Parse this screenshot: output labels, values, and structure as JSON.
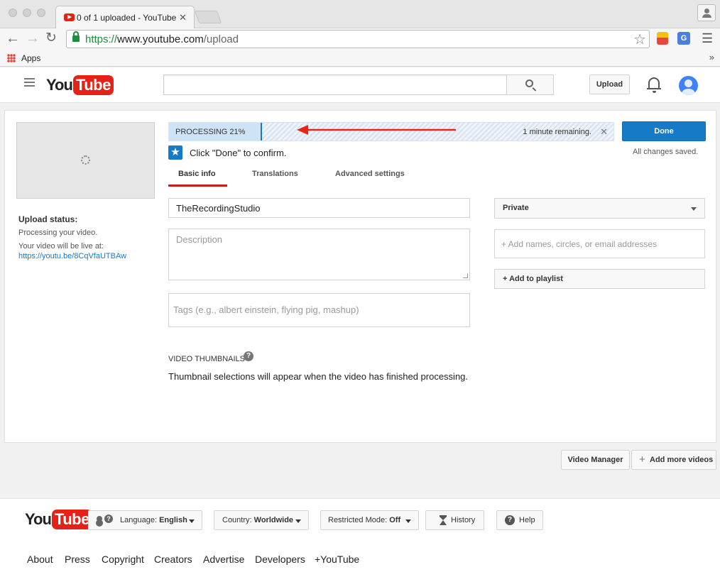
{
  "browser": {
    "tab_title": "0 of 1 uploaded - YouTube",
    "tab_close": "✕",
    "url_scheme": "https://",
    "url_host": "www.youtube.com",
    "url_path": "/upload",
    "bookmarks_apps": "Apps",
    "bookmarks_more": "»"
  },
  "youtube": {
    "logo_you": "You",
    "logo_tube": "Tube",
    "upload_button": "Upload"
  },
  "upload": {
    "status_title": "Upload status:",
    "processing_msg": "Processing your video.",
    "live_at": "Your video will be live at:",
    "live_link": "https://youtu.be/8CqVfaUTBAw",
    "progress_label": "PROCESSING 21%",
    "progress_fraction": 0.21,
    "remaining": "1 minute remaining.",
    "progress_close": "✕",
    "done_button": "Done",
    "saved_msg": "All changes saved.",
    "confirm_msg": "Click \"Done\" to confirm.",
    "confirm_icon": "★"
  },
  "tabs": [
    "Basic info",
    "Translations",
    "Advanced settings"
  ],
  "form": {
    "title_value": "TheRecordingStudio",
    "description_placeholder": "Description",
    "tags_placeholder": "Tags (e.g., albert einstein, flying pig, mashup)",
    "privacy_value": "Private",
    "share_placeholder": "+ Add names, circles, or email addresses",
    "playlist_button": "+ Add to playlist"
  },
  "thumbnails": {
    "title": "VIDEO THUMBNAILS",
    "help_icon": "?",
    "message": "Thumbnail selections will appear when the video has finished processing."
  },
  "actions": {
    "video_manager": "Video Manager",
    "add_more_plus": "+",
    "add_more_videos": "Add more videos"
  },
  "footer": {
    "language_prefix": "Language:",
    "language_value": "English",
    "country_prefix": "Country:",
    "country_value": "Worldwide",
    "restricted_prefix": "Restricted Mode:",
    "restricted_value": "Off",
    "history": "History",
    "help": "Help",
    "help_icon": "?",
    "links": [
      "About",
      "Press",
      "Copyright",
      "Creators",
      "Advertise",
      "Developers",
      "+YouTube"
    ]
  },
  "colors": {
    "brand_red": "#e62117",
    "accent_blue": "#167ac6",
    "tab_underline": "#cc181e"
  }
}
